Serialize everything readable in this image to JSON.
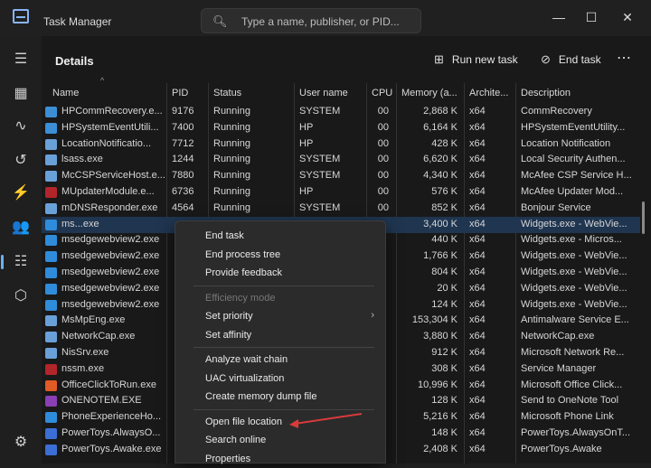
{
  "window": {
    "title": "Task Manager",
    "minimize_glyph": "—",
    "maximize_glyph": "☐",
    "close_glyph": "✕"
  },
  "search": {
    "placeholder": "Type a name, publisher, or PID..."
  },
  "sidebar": {
    "items": [
      {
        "icon": "hamburger-menu-icon",
        "glyph": "☰"
      },
      {
        "icon": "processes-icon",
        "glyph": "▦"
      },
      {
        "icon": "performance-icon",
        "glyph": "∿"
      },
      {
        "icon": "app-history-icon",
        "glyph": "↺"
      },
      {
        "icon": "startup-apps-icon",
        "glyph": "⚡"
      },
      {
        "icon": "users-icon",
        "glyph": "👥"
      },
      {
        "icon": "details-icon",
        "glyph": "☷"
      },
      {
        "icon": "services-icon",
        "glyph": "⬡"
      },
      {
        "icon": "settings-icon",
        "glyph": "⚙"
      }
    ]
  },
  "toolbar": {
    "title": "Details",
    "run_new_task": "Run new task",
    "end_task": "End task",
    "more": "⋯"
  },
  "columns": [
    "Name",
    "PID",
    "Status",
    "User name",
    "CPU",
    "Memory (a...",
    "Archite...",
    "Description"
  ],
  "rows": [
    {
      "name": "HPCommRecovery.e...",
      "pid": "9176",
      "status": "Running",
      "user": "SYSTEM",
      "cpu": "00",
      "mem": "2,868 K",
      "arch": "x64",
      "desc": "CommRecovery",
      "color": "#3b8fd6"
    },
    {
      "name": "HPSystemEventUtili...",
      "pid": "7400",
      "status": "Running",
      "user": "HP",
      "cpu": "00",
      "mem": "6,164 K",
      "arch": "x64",
      "desc": "HPSystemEventUtility...",
      "color": "#3b8fd6"
    },
    {
      "name": "LocationNotificatio...",
      "pid": "7712",
      "status": "Running",
      "user": "HP",
      "cpu": "00",
      "mem": "428 K",
      "arch": "x64",
      "desc": "Location Notification",
      "color": "#6aa0d8"
    },
    {
      "name": "lsass.exe",
      "pid": "1244",
      "status": "Running",
      "user": "SYSTEM",
      "cpu": "00",
      "mem": "6,620 K",
      "arch": "x64",
      "desc": "Local Security Authen...",
      "color": "#6aa0d8"
    },
    {
      "name": "McCSPServiceHost.e...",
      "pid": "7880",
      "status": "Running",
      "user": "SYSTEM",
      "cpu": "00",
      "mem": "4,340 K",
      "arch": "x64",
      "desc": "McAfee CSP Service H...",
      "color": "#6aa0d8"
    },
    {
      "name": "MUpdaterModule.e...",
      "pid": "6736",
      "status": "Running",
      "user": "HP",
      "cpu": "00",
      "mem": "576 K",
      "arch": "x64",
      "desc": "McAfee Updater Mod...",
      "color": "#b2252b"
    },
    {
      "name": "mDNSResponder.exe",
      "pid": "4564",
      "status": "Running",
      "user": "SYSTEM",
      "cpu": "00",
      "mem": "852 K",
      "arch": "x64",
      "desc": "Bonjour Service",
      "color": "#6aa0d8"
    },
    {
      "name": "ms...exe",
      "pid": "",
      "status": "",
      "user": "",
      "cpu": "",
      "mem": "3,400 K",
      "arch": "x64",
      "desc": "Widgets.exe - WebVie...",
      "color": "#2f8cdb",
      "hl": true
    },
    {
      "name": "msedgewebview2.exe",
      "pid": "",
      "status": "",
      "user": "",
      "cpu": "",
      "mem": "440 K",
      "arch": "x64",
      "desc": "Widgets.exe - Micros...",
      "color": "#2f8cdb"
    },
    {
      "name": "msedgewebview2.exe",
      "pid": "",
      "status": "",
      "user": "",
      "cpu": "",
      "mem": "1,766 K",
      "arch": "x64",
      "desc": "Widgets.exe - WebVie...",
      "color": "#2f8cdb"
    },
    {
      "name": "msedgewebview2.exe",
      "pid": "",
      "status": "",
      "user": "",
      "cpu": "",
      "mem": "804 K",
      "arch": "x64",
      "desc": "Widgets.exe - WebVie...",
      "color": "#2f8cdb"
    },
    {
      "name": "msedgewebview2.exe",
      "pid": "",
      "status": "",
      "user": "",
      "cpu": "",
      "mem": "20 K",
      "arch": "x64",
      "desc": "Widgets.exe - WebVie...",
      "color": "#2f8cdb"
    },
    {
      "name": "msedgewebview2.exe",
      "pid": "",
      "status": "",
      "user": "",
      "cpu": "",
      "mem": "124 K",
      "arch": "x64",
      "desc": "Widgets.exe - WebVie...",
      "color": "#2f8cdb"
    },
    {
      "name": "MsMpEng.exe",
      "pid": "",
      "status": "",
      "user": "",
      "cpu": "",
      "mem": "153,304 K",
      "arch": "x64",
      "desc": "Antimalware Service E...",
      "color": "#6aa0d8"
    },
    {
      "name": "NetworkCap.exe",
      "pid": "",
      "status": "",
      "user": "",
      "cpu": "",
      "mem": "3,880 K",
      "arch": "x64",
      "desc": "NetworkCap.exe",
      "color": "#6aa0d8"
    },
    {
      "name": "NisSrv.exe",
      "pid": "",
      "status": "",
      "user": "",
      "cpu": "",
      "mem": "912 K",
      "arch": "x64",
      "desc": "Microsoft Network Re...",
      "color": "#6aa0d8"
    },
    {
      "name": "nssm.exe",
      "pid": "",
      "status": "",
      "user": "",
      "cpu": "",
      "mem": "308 K",
      "arch": "x64",
      "desc": "Service Manager",
      "color": "#b2252b"
    },
    {
      "name": "OfficeClickToRun.exe",
      "pid": "",
      "status": "",
      "user": "",
      "cpu": "",
      "mem": "10,996 K",
      "arch": "x64",
      "desc": "Microsoft Office Click...",
      "color": "#e05b25"
    },
    {
      "name": "ONENOTEM.EXE",
      "pid": "",
      "status": "",
      "user": "",
      "cpu": "",
      "mem": "128 K",
      "arch": "x64",
      "desc": "Send to OneNote Tool",
      "color": "#8a3fb5"
    },
    {
      "name": "PhoneExperienceHo...",
      "pid": "",
      "status": "",
      "user": "",
      "cpu": "",
      "mem": "5,216 K",
      "arch": "x64",
      "desc": "Microsoft Phone Link",
      "color": "#2f8cdb"
    },
    {
      "name": "PowerToys.AlwaysO...",
      "pid": "",
      "status": "",
      "user": "",
      "cpu": "",
      "mem": "148 K",
      "arch": "x64",
      "desc": "PowerToys.AlwaysOnT...",
      "color": "#3b6fd6"
    },
    {
      "name": "PowerToys.Awake.exe",
      "pid": "",
      "status": "",
      "user": "",
      "cpu": "",
      "mem": "2,408 K",
      "arch": "x64",
      "desc": "PowerToys.Awake",
      "color": "#3b6fd6"
    }
  ],
  "context_menu": {
    "items": [
      {
        "label": "End task",
        "kind": "item"
      },
      {
        "label": "End process tree",
        "kind": "item"
      },
      {
        "label": "Provide feedback",
        "kind": "item"
      },
      {
        "kind": "sep"
      },
      {
        "label": "Efficiency mode",
        "kind": "disabled"
      },
      {
        "label": "Set priority",
        "kind": "submenu"
      },
      {
        "label": "Set affinity",
        "kind": "item"
      },
      {
        "kind": "sep"
      },
      {
        "label": "Analyze wait chain",
        "kind": "item"
      },
      {
        "label": "UAC virtualization",
        "kind": "item"
      },
      {
        "label": "Create memory dump file",
        "kind": "item"
      },
      {
        "kind": "sep"
      },
      {
        "label": "Open file location",
        "kind": "item"
      },
      {
        "label": "Search online",
        "kind": "item"
      },
      {
        "label": "Properties",
        "kind": "item"
      }
    ]
  },
  "annotation": {
    "arrow_color": "#d93a3a"
  }
}
